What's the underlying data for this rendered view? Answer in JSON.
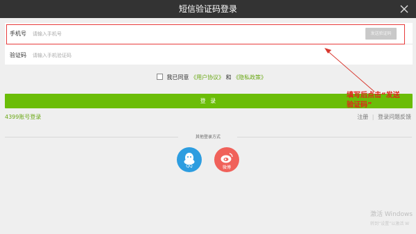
{
  "window": {
    "title": "短信验证码登录"
  },
  "form": {
    "phone_label": "手机号",
    "phone_placeholder": "请输入手机号",
    "send_code": "发送验证码",
    "code_label": "验证码",
    "code_placeholder": "请输入手机验证码"
  },
  "agreement": {
    "prefix": "我已同意",
    "user_agreement": "《用户协议》",
    "and": "和",
    "privacy_policy": "《隐私政策》"
  },
  "login_button": "登 录",
  "links": {
    "account_login": "4399账号登录",
    "register": "注册",
    "separator": "|",
    "feedback": "登录问题反馈"
  },
  "other_login": {
    "title": "其他登录方式",
    "qq": "QQ",
    "weibo": "微博"
  },
  "annotation": {
    "line1": "填写后点击“发送",
    "line2": "验证码”"
  },
  "watermark": {
    "line1": "激活 Windows",
    "line2": "转到“设置”以激活 W"
  },
  "colors": {
    "accent_green": "#6bbd08",
    "annotation_red": "#e2231a",
    "titlebar": "#333333"
  },
  "icons": {
    "close": "close-icon",
    "qq": "qq-penguin-icon",
    "weibo": "weibo-eye-icon"
  }
}
